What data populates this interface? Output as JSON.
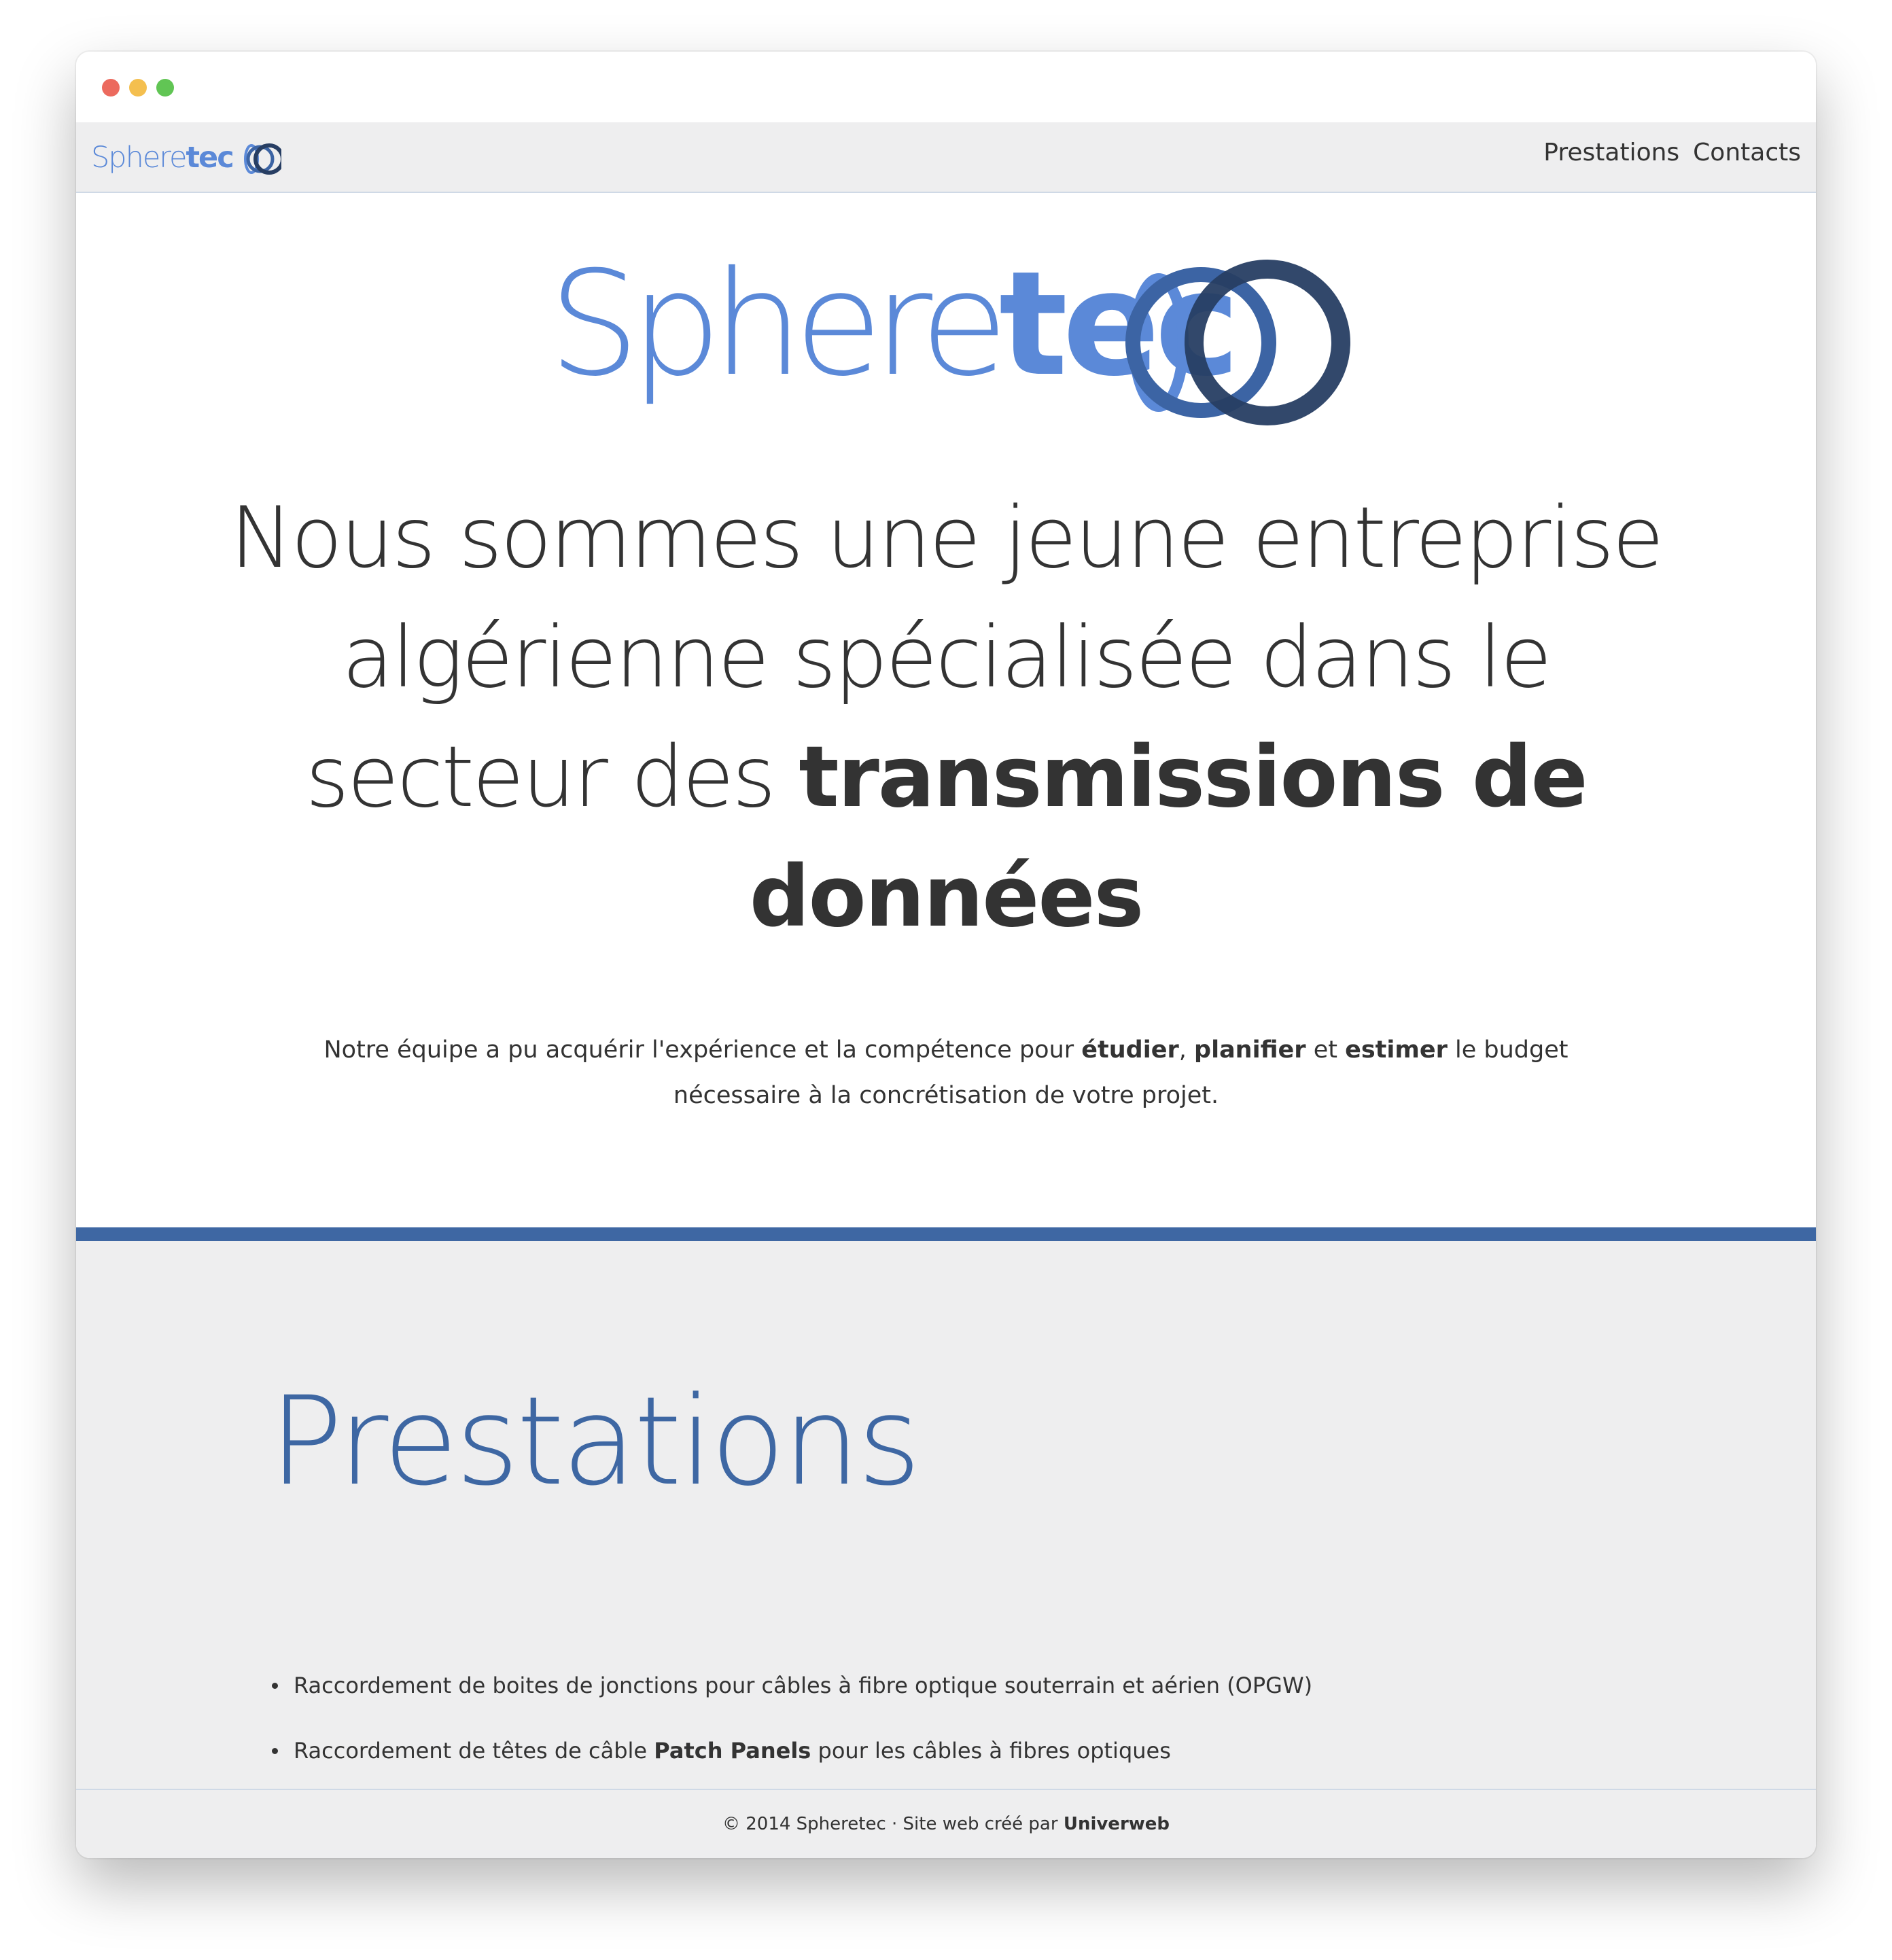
{
  "brand": {
    "name_part1": "Sphere",
    "name_part2": "tec",
    "color_light": "#5b89d8",
    "color_mid": "#3c64a4",
    "color_dark": "#273e63"
  },
  "nav": {
    "items": [
      {
        "label": "Prestations"
      },
      {
        "label": "Contacts"
      }
    ]
  },
  "hero": {
    "headline_light": "Nous sommes une jeune entreprise algérienne spécialisée dans le secteur des",
    "headline_bold": "transmissions de données",
    "intro": {
      "part1": "Notre équipe a pu acquérir l'expérience et la compétence pour",
      "bold1": "étudier",
      "sep1": ",",
      "bold2": "planifier",
      "part2": "et",
      "bold3": "estimer",
      "part3": "le budget nécessaire à la concrétisation de votre projet."
    }
  },
  "services": {
    "title": "Prestations",
    "items": [
      {
        "text": "Raccordement de boites de jonctions pour câbles à fibre optique souterrain et aérien (OPGW)"
      },
      {
        "before": "Raccordement de têtes de câble",
        "bold": "Patch Panels",
        "after": "pour les câbles à fibres optiques"
      }
    ]
  },
  "footer": {
    "text": "© 2014 Spheretec · Site web créé par",
    "credit": "Univerweb"
  },
  "colors": {
    "accent": "#3e67a3",
    "panel_bg": "#eeeeef",
    "text": "#333333"
  }
}
